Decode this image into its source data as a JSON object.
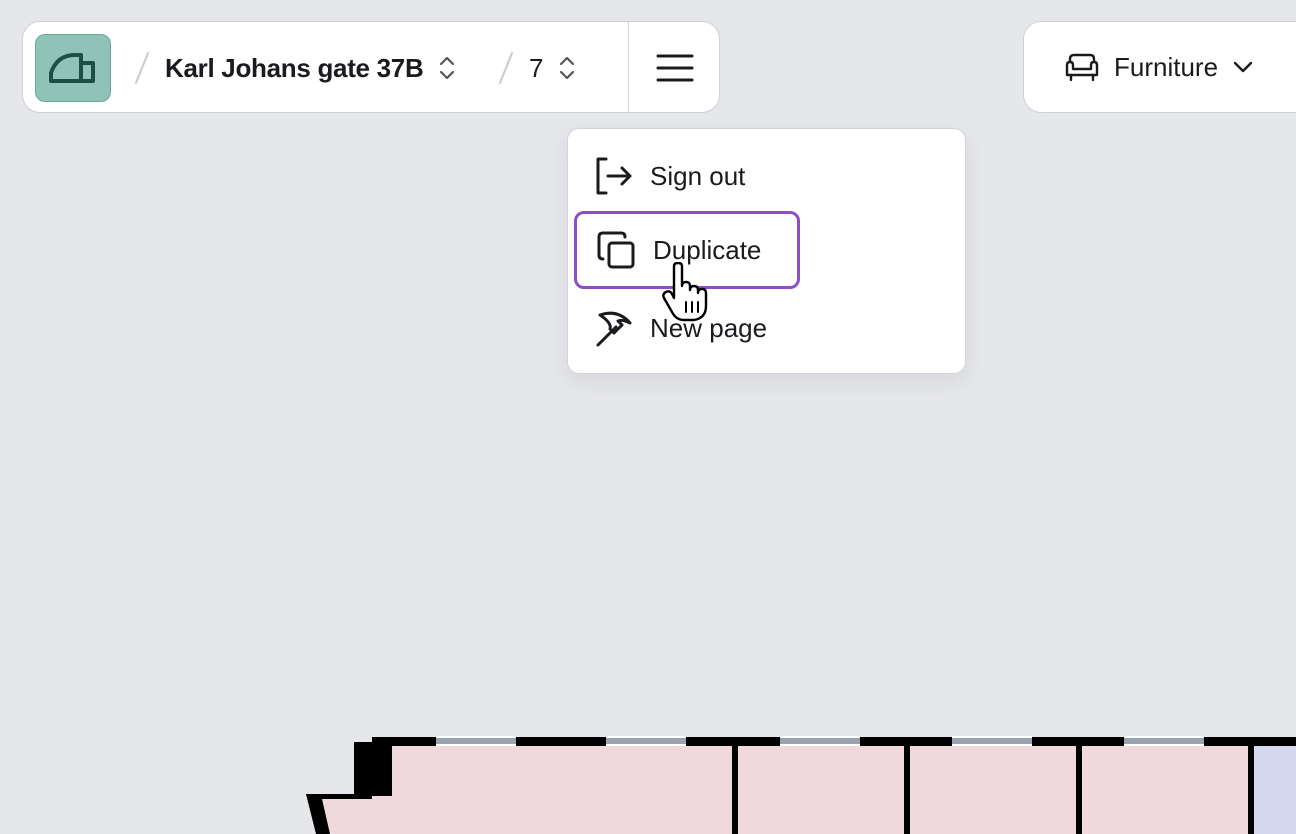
{
  "toolbar": {
    "building": "Karl Johans gate 37B",
    "floor": "7",
    "logo_color": "#8fc3b8"
  },
  "category": {
    "label": "Furniture"
  },
  "menu": {
    "items": [
      {
        "label": "Sign out",
        "icon": "sign-out-icon"
      },
      {
        "label": "Duplicate",
        "icon": "duplicate-icon",
        "highlighted": true
      },
      {
        "label": "New page",
        "icon": "pickaxe-icon"
      }
    ],
    "highlight_color": "#8e4fc6"
  },
  "floorplan": {
    "room_color": "#f0d9dd",
    "side_room_color": "#d6d8f0",
    "wall_color": "#000000"
  }
}
